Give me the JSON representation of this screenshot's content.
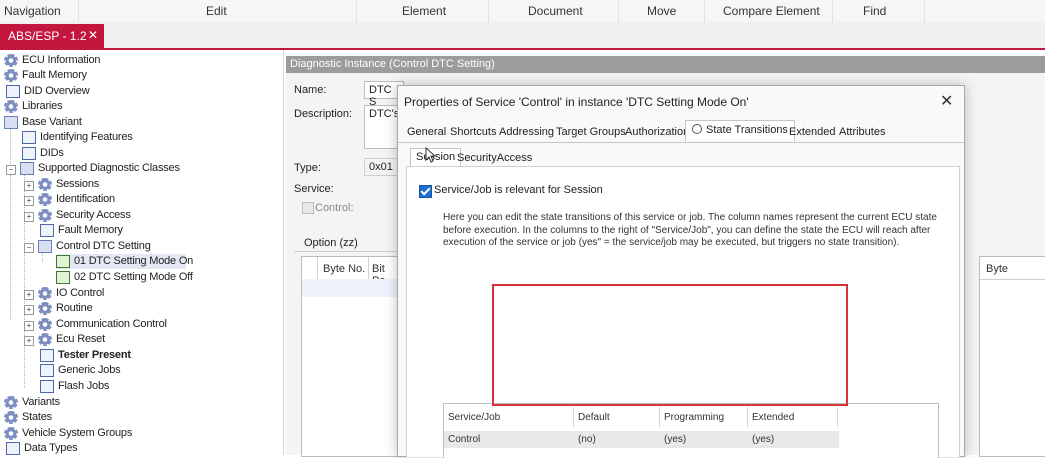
{
  "menu": [
    "Navigation",
    "Edit",
    "Element",
    "Document",
    "Move",
    "Compare Element",
    "Find"
  ],
  "doc_tab": {
    "label": "ABS/ESP - 1.2",
    "close": "✕"
  },
  "tree": {
    "ecu_information": "ECU Information",
    "fault_memory": "Fault Memory",
    "did_overview": "DID Overview",
    "libraries": "Libraries",
    "base_variant": "Base Variant",
    "identifying_features": "Identifying Features",
    "dids": "DIDs",
    "supported_classes": "Supported Diagnostic Classes",
    "sessions": "Sessions",
    "identification": "Identification",
    "security_access": "Security Access",
    "fault_memory_sub": "Fault Memory",
    "control_dtc": "Control DTC Setting",
    "dtc_on": "01 DTC Setting Mode On",
    "dtc_off": "02 DTC Setting Mode Off",
    "io_control": "IO Control",
    "routine": "Routine",
    "communication_control": "Communication Control",
    "ecu_reset": "Ecu Reset",
    "tester_present": "Tester Present",
    "generic_jobs": "Generic Jobs",
    "flash_jobs": "Flash Jobs",
    "variants": "Variants",
    "states": "States",
    "vehicle_system_groups": "Vehicle System Groups",
    "data_types": "Data Types"
  },
  "panel": {
    "header": "Diagnostic Instance (Control DTC Setting)",
    "name_label": "Name:",
    "name_value": "DTC S",
    "description_label": "Description:",
    "description_value": "DTC's",
    "type_label": "Type:",
    "type_value": "0x01",
    "service_label": "Service:",
    "control_label": "Control:",
    "option_label": "Option (zz)",
    "col_byte_no": "Byte No.",
    "col_bit_po": "Bit Po",
    "col_byte": "Byte"
  },
  "dialog": {
    "title": "Properties of Service 'Control' in instance 'DTC Setting Mode On'",
    "close": "✕",
    "tabs": [
      "General",
      "Shortcuts",
      "Addressing",
      "Target Groups",
      "Authorization",
      "State Transitions",
      "Extended",
      "Attributes"
    ],
    "subtabs": [
      "Session",
      "SecurityAccess"
    ],
    "checkbox_label": "Service/Job is relevant for Session",
    "description": "Here you can edit the state transitions of this service or job. The column names represent the current ECU state before execution. In the columns to the right of \"Service/Job\", you can define the state the ECU will reach after execution of the service or job (yes\" = the service/job may be executed, but triggers no state transition).",
    "table": {
      "headers": [
        "Service/Job",
        "Default",
        "Programming",
        "Extended"
      ],
      "row": [
        "Control",
        "(no)",
        "(yes)",
        "(yes)"
      ]
    }
  },
  "colors": {
    "accent": "#c3163f",
    "highlight": "#d8323a",
    "checkbox": "#1f6fd1"
  }
}
